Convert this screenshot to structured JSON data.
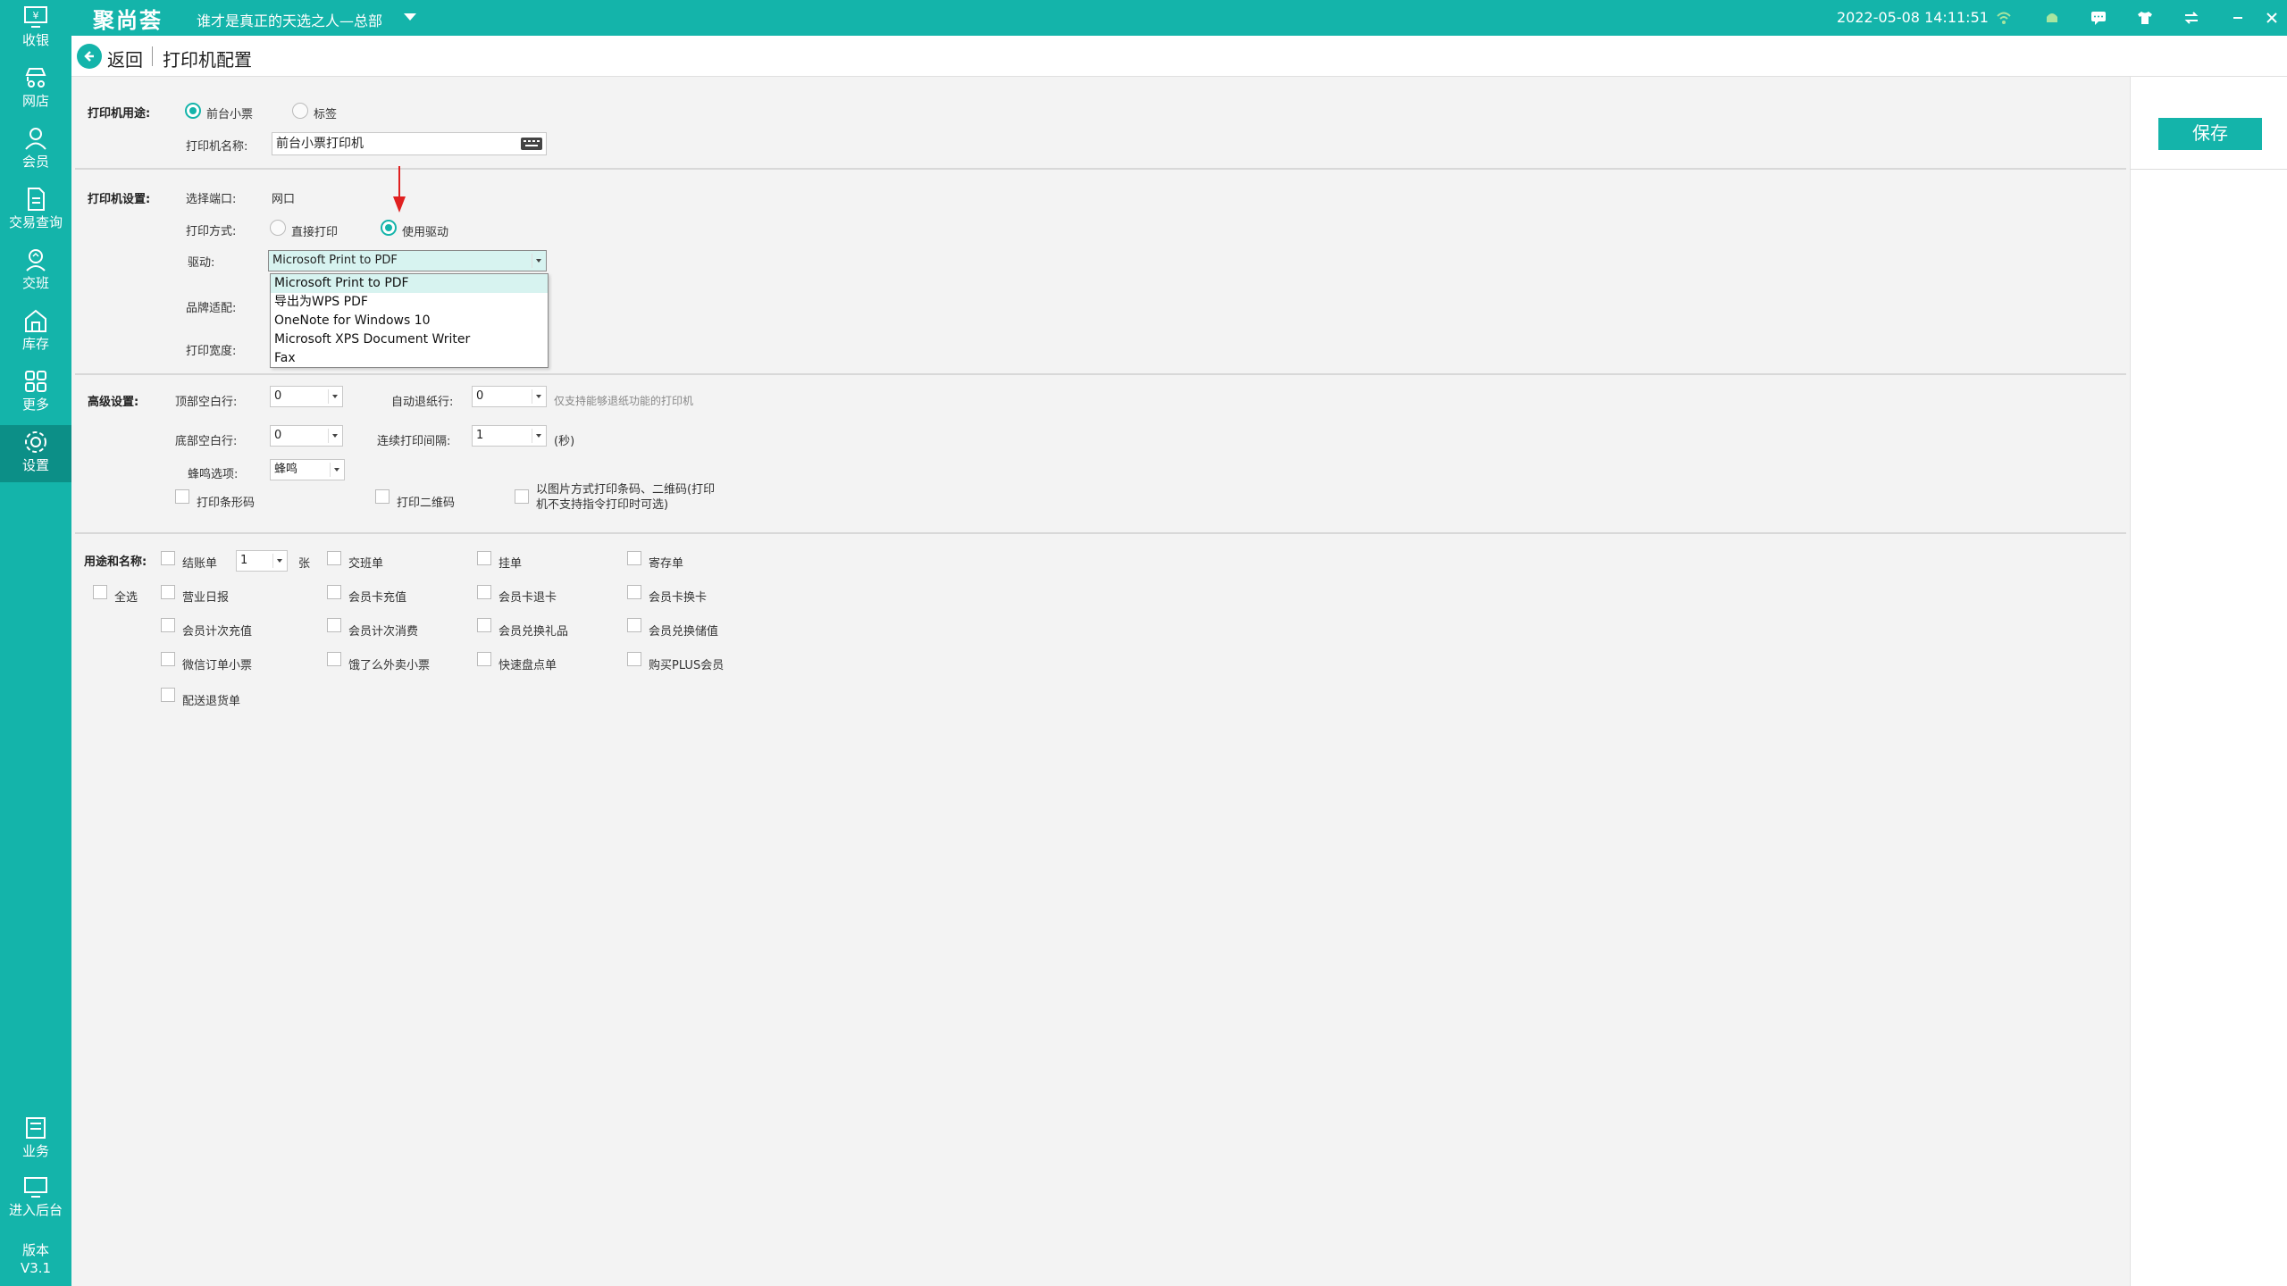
{
  "topbar": {
    "logo": "聚尚荟",
    "store": "谁才是真正的天选之人—总部",
    "datetime": "2022-05-08 14:11:51"
  },
  "sidebar": {
    "items": [
      {
        "label": "收银",
        "icon": "cashier-icon"
      },
      {
        "label": "网店",
        "icon": "online-store-icon"
      },
      {
        "label": "会员",
        "icon": "member-icon"
      },
      {
        "label": "交易查询",
        "icon": "transaction-icon"
      },
      {
        "label": "交班",
        "icon": "shift-icon"
      },
      {
        "label": "库存",
        "icon": "inventory-icon"
      },
      {
        "label": "更多",
        "icon": "more-icon"
      },
      {
        "label": "设置",
        "icon": "settings-icon"
      }
    ],
    "bottom": [
      {
        "label": "业务",
        "icon": "business-icon"
      },
      {
        "label": "进入后台",
        "icon": "backend-icon"
      }
    ],
    "version_label": "版本",
    "version": "V3.1"
  },
  "subheader": {
    "back": "返回",
    "title": "打印机配置"
  },
  "save": "保存",
  "form": {
    "purpose_label": "打印机用途:",
    "purpose_options": [
      "前台小票",
      "标签"
    ],
    "name_label": "打印机名称:",
    "name_value": "前台小票打印机",
    "settings_label": "打印机设置:",
    "port_label": "选择端口:",
    "port_value": "网口",
    "method_label": "打印方式:",
    "method_options": [
      "直接打印",
      "使用驱动"
    ],
    "driver_label": "驱动:",
    "driver_value": "Microsoft Print to PDF",
    "driver_options": [
      "Microsoft Print to PDF",
      "导出为WPS PDF",
      "OneNote for Windows 10",
      "Microsoft XPS Document Writer",
      "Fax"
    ],
    "brand_label": "品牌适配:",
    "width_label": "打印宽度:",
    "advanced_label": "高级设置:",
    "top_blank_label": "顶部空白行:",
    "top_blank_value": "0",
    "auto_feed_label": "自动退纸行:",
    "auto_feed_value": "0",
    "auto_feed_hint": "仅支持能够退纸功能的打印机",
    "bottom_blank_label": "底部空白行:",
    "bottom_blank_value": "0",
    "interval_label": "连续打印间隔:",
    "interval_value": "1",
    "interval_unit": "(秒)",
    "buzzer_label": "蜂鸣选项:",
    "buzzer_value": "蜂鸣",
    "print_barcode": "打印条形码",
    "print_qrcode": "打印二维码",
    "image_mode_line1": "以图片方式打印条码、二维码(打印",
    "image_mode_line2": "机不支持指令打印时可选)",
    "usage_label": "用途和名称:",
    "select_all": "全选",
    "copies_value": "1",
    "copies_unit": "张",
    "usage_items": {
      "checkout": "结账单",
      "shift": "交班单",
      "hold": "挂单",
      "deposit": "寄存单",
      "daily_report": "营业日报",
      "card_recharge": "会员卡充值",
      "card_refund": "会员卡退卡",
      "card_exchange": "会员卡换卡",
      "times_recharge": "会员计次充值",
      "times_consume": "会员计次消费",
      "gift_exchange": "会员兑换礼品",
      "value_exchange": "会员兑换储值",
      "wechat_order": "微信订单小票",
      "eleme": "饿了么外卖小票",
      "stocktake": "快速盘点单",
      "plus_member": "购买PLUS会员",
      "delivery_return": "配送退货单"
    }
  }
}
